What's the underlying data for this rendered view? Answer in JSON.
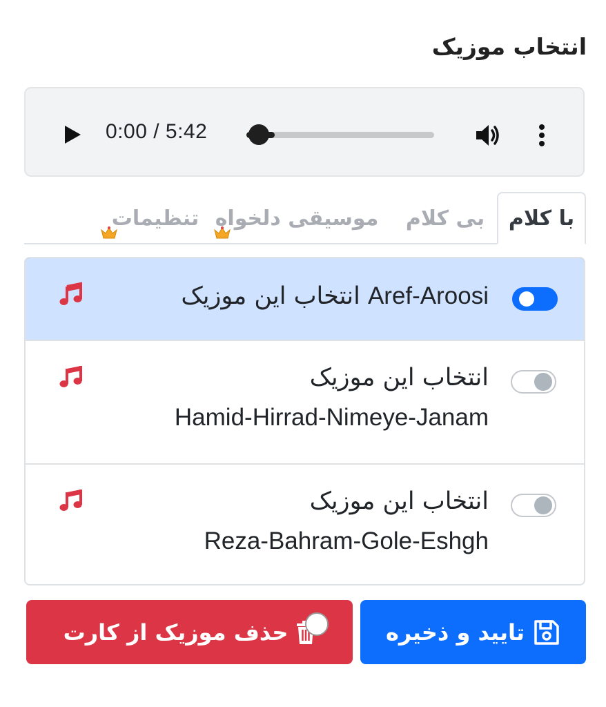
{
  "page_title": "انتخاب موزیک",
  "player": {
    "time": "0:00 / 5:42",
    "progress": 0.04,
    "play_icon": "play-icon",
    "volume_icon": "volume-icon",
    "more_icon": "more-vert-icon"
  },
  "tabs": [
    {
      "label": "با کلام",
      "active": true
    },
    {
      "label": "بی کلام",
      "active": false
    },
    {
      "label": "موسیقی دلخواه",
      "active": false,
      "crown": true
    },
    {
      "label": "تنظیمات",
      "active": false,
      "crown": true
    }
  ],
  "songs": [
    {
      "name": "Aref-Aroosi",
      "select_label": "انتخاب این موزیک",
      "selected": true
    },
    {
      "name": "Hamid-Hirrad-Nimeye-Janam",
      "select_label": "انتخاب این موزیک",
      "selected": false
    },
    {
      "name": "Reza-Bahram-Gole-Eshgh",
      "select_label": "انتخاب این موزیک",
      "selected": false
    }
  ],
  "buttons": {
    "save_label": "تایید و ذخیره",
    "delete_label": "حذف موزیک از کارت"
  },
  "colors": {
    "primary": "#0d6efd",
    "danger": "#dc3545",
    "selected_row": "#cfe2ff",
    "note": "#dc3545"
  }
}
